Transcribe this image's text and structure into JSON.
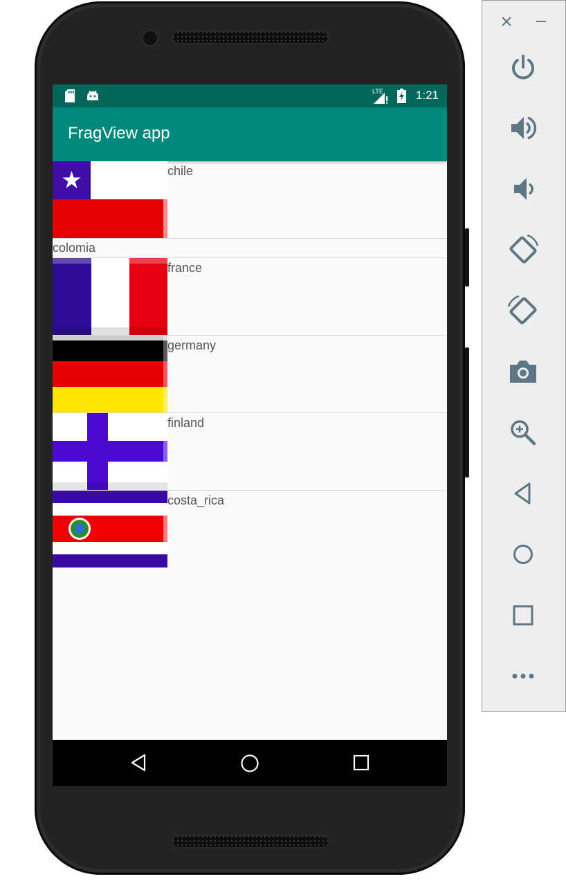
{
  "status_bar": {
    "time": "1:21",
    "network_label": "LTE",
    "icons": [
      "sd-card-icon",
      "android-icon",
      "signal-icon",
      "battery-icon"
    ]
  },
  "app_bar": {
    "title": "FragView app"
  },
  "list": {
    "items": [
      {
        "label": "chile",
        "flag": "chile-flag"
      },
      {
        "label": "colomia",
        "flag": null
      },
      {
        "label": "france",
        "flag": "france-flag"
      },
      {
        "label": "germany",
        "flag": "germany-flag"
      },
      {
        "label": "finland",
        "flag": "finland-flag"
      },
      {
        "label": "costa_rica",
        "flag": "costa-rica-flag"
      }
    ]
  },
  "nav_bar": {
    "buttons": [
      "back-icon",
      "home-icon",
      "recents-icon"
    ]
  },
  "emulator_panel": {
    "buttons": [
      "close-icon",
      "minimize-icon",
      "power-icon",
      "volume-up-icon",
      "volume-down-icon",
      "rotate-left-icon",
      "rotate-right-icon",
      "camera-icon",
      "zoom-icon",
      "back-icon",
      "home-icon",
      "overview-icon",
      "more-icon"
    ]
  },
  "colors": {
    "primary": "#00897b",
    "primary_dark": "#00675b",
    "panel_icon": "#5f7785"
  }
}
